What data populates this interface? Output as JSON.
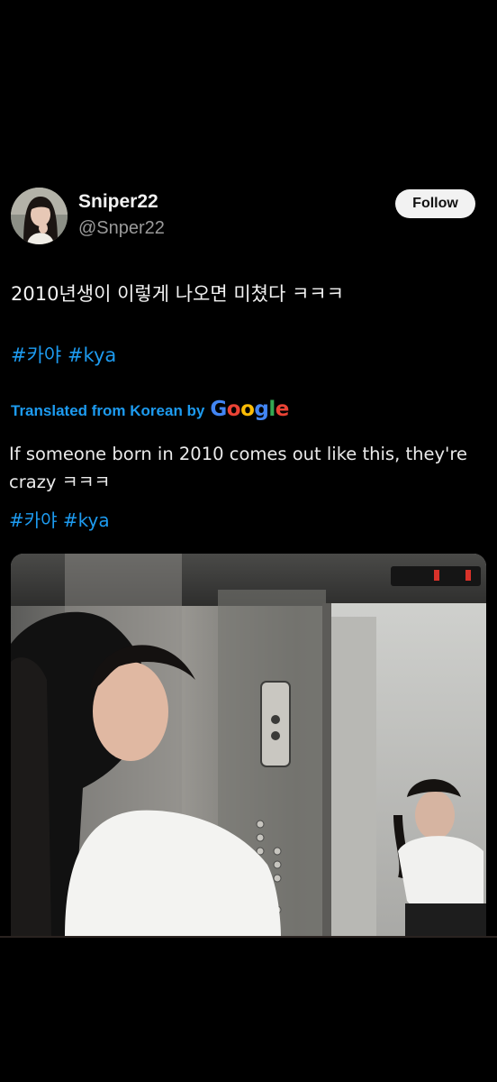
{
  "tweet": {
    "display_name": "Sniper22",
    "handle": "@Snper22",
    "follow_label": "Follow",
    "text": "2010년생이 이렇게 나오면 미쳤다 ㅋㅋㅋ",
    "hashtags": [
      "#카야",
      "#kya"
    ],
    "translation_label": "Translated from Korean by",
    "translation_provider": "Google",
    "translated_text": "If someone born in 2010 comes out like this, they're crazy ㅋㅋㅋ",
    "translated_hashtags": [
      "#카야",
      "#kya"
    ]
  },
  "colors": {
    "background": "#000000",
    "link": "#1d9bf0",
    "text": "#f2f2f2",
    "secondary_text": "#9a9a9a",
    "button_bg": "#f2f2f2",
    "google_blue": "#4285f4",
    "google_red": "#ea4335",
    "google_yellow": "#fbbc05",
    "google_green": "#34a853"
  },
  "icons": {
    "avatar": "profile-photo",
    "media": "elevator-mirror-photo",
    "elevator_display": "floor-indicator"
  }
}
